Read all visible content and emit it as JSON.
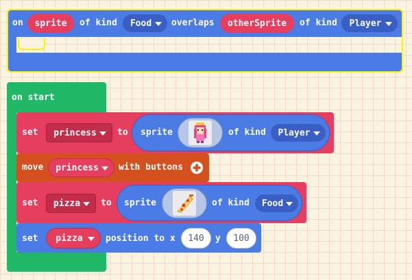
{
  "overlap_block": {
    "w_on": "on",
    "sprite_var": "sprite",
    "w_of_kind_1": "of kind",
    "kind_1": "Food",
    "w_overlaps": "overlaps",
    "other_var": "otherSprite",
    "w_of_kind_2": "of kind",
    "kind_2": "Player"
  },
  "start_block": {
    "label": "on start",
    "set_princess": {
      "w_set": "set",
      "variable": "princess",
      "w_to": "to",
      "w_sprite": "sprite",
      "image_icon": "princess-sprite-image",
      "w_of_kind": "of kind",
      "kind": "Player"
    },
    "move_block": {
      "w_move": "move",
      "variable": "princess",
      "w_with_buttons": "with buttons",
      "expand_icon": "plus-circle-icon"
    },
    "set_pizza": {
      "w_set": "set",
      "variable": "pizza",
      "w_to": "to",
      "w_sprite": "sprite",
      "image_icon": "pizza-sprite-image",
      "w_of_kind": "of kind",
      "kind": "Food"
    },
    "set_position": {
      "w_set": "set",
      "variable": "pizza",
      "w_position": "position to x",
      "x": "140",
      "w_y": "y",
      "y": "100"
    }
  },
  "colors": {
    "canvas": "#fbf3e2",
    "sprites_blue": "#4b7be4",
    "variables_red": "#e63e5e",
    "controller_orange": "#d4501f",
    "loops_green": "#21b868",
    "selection_yellow": "#fff200"
  }
}
